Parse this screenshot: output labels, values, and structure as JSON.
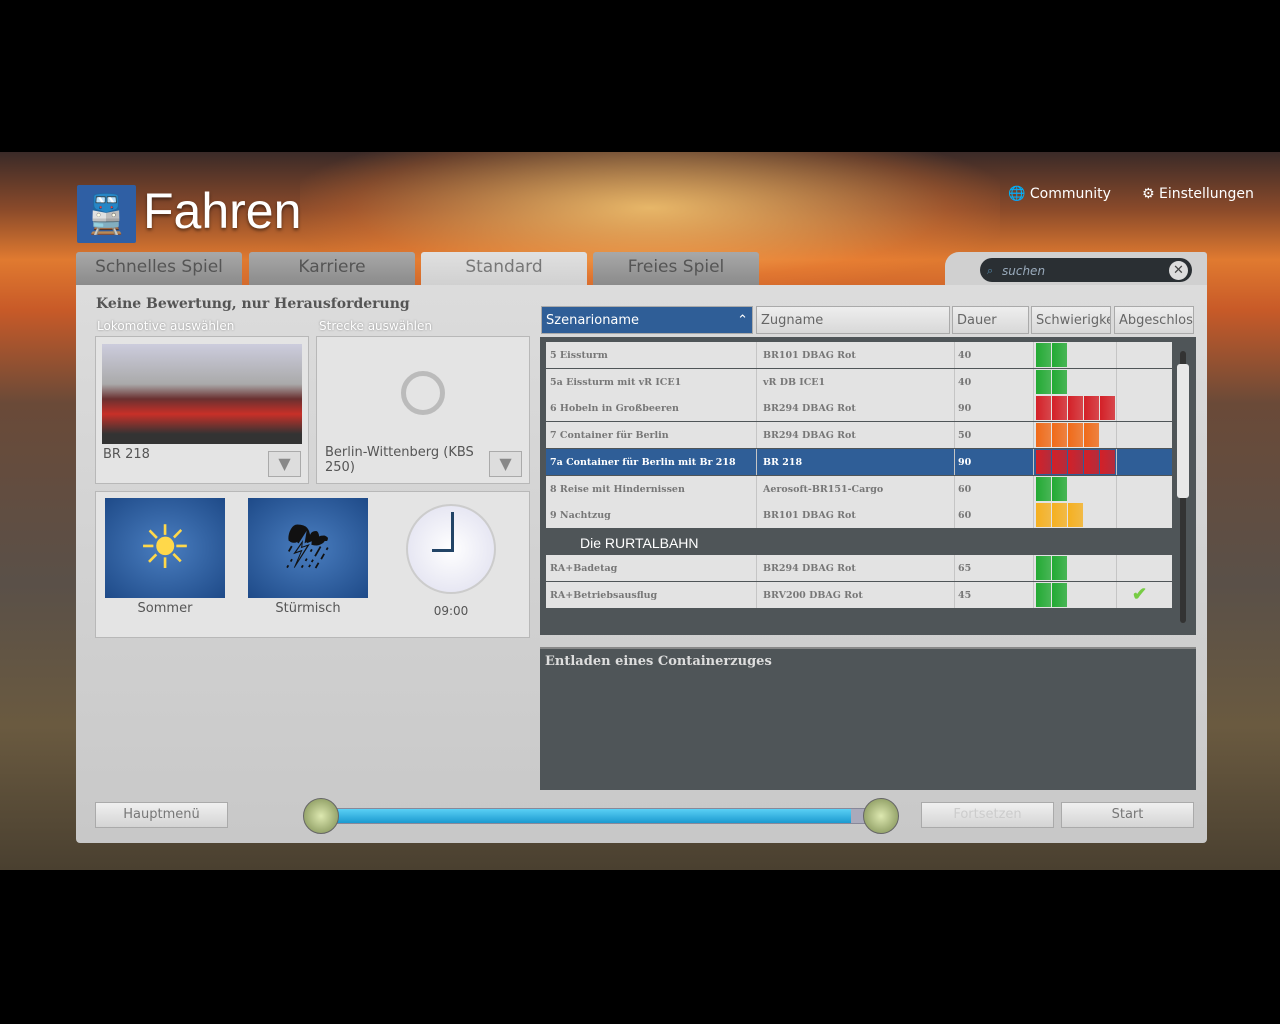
{
  "app": {
    "title": "Fahren",
    "community": "Community",
    "settings": "Einstellungen",
    "search_placeholder": "suchen"
  },
  "tabs": [
    "Schnelles Spiel",
    "Karriere",
    "Standard",
    "Freies Spiel"
  ],
  "left": {
    "heading": "Keine Bewertung, nur Herausforderung",
    "loco_label": "Lokomotive auswählen",
    "route_label": "Strecke auswählen",
    "loco": "BR 218",
    "route": "Berlin-Wittenberg (KBS 250)",
    "weather1": "Sommer",
    "weather2": "Stürmisch",
    "time": "09:00"
  },
  "table": {
    "headers": [
      "Szenarioname",
      "Zugname",
      "Dauer",
      "Schwierigke",
      "Abgeschlos"
    ],
    "rows": [
      {
        "name": "5 Eissturm",
        "train": "BR101 DBAG Rot",
        "dur": "40",
        "diff": 2,
        "color": "#22aa33",
        "done": false
      },
      {
        "name": "5a Eissturm mit vR ICE1",
        "train": "vR DB ICE1",
        "dur": "40",
        "diff": 2,
        "color": "#22aa33",
        "done": false
      },
      {
        "name": "6 Hobeln in Großbeeren",
        "train": "BR294 DBAG Rot",
        "dur": "90",
        "diff": 5,
        "color": "#d42027",
        "done": false
      },
      {
        "name": "7 Container für Berlin",
        "train": "BR294 DBAG Rot",
        "dur": "50",
        "diff": 4,
        "color": "#f06a18",
        "done": false
      },
      {
        "name": "7a Container für Berlin mit Br 218",
        "train": "BR 218",
        "dur": "90",
        "diff": 5,
        "color": "#d42027",
        "done": false,
        "selected": true
      },
      {
        "name": "8 Reise mit Hindernissen",
        "train": "Aerosoft-BR151-Cargo",
        "dur": "60",
        "diff": 2,
        "color": "#22aa33",
        "done": false
      },
      {
        "name": "9 Nachtzug",
        "train": "BR101 DBAG Rot",
        "dur": "60",
        "diff": 3,
        "color": "#f5b020",
        "done": false
      }
    ],
    "group": "Die RURTALBAHN",
    "rows2": [
      {
        "name": "RA+Badetag",
        "train": "BR294 DBAG Rot",
        "dur": "65",
        "diff": 2,
        "color": "#22aa33",
        "done": false
      },
      {
        "name": "RA+Betriebsausflug",
        "train": "BRV200 DBAG Rot",
        "dur": "45",
        "diff": 2,
        "color": "#22aa33",
        "done": true
      }
    ]
  },
  "description": "Entladen eines Containerzuges",
  "progress": 0.95,
  "buttons": {
    "main_menu": "Hauptmenü",
    "continue": "Fortsetzen",
    "start": "Start"
  }
}
